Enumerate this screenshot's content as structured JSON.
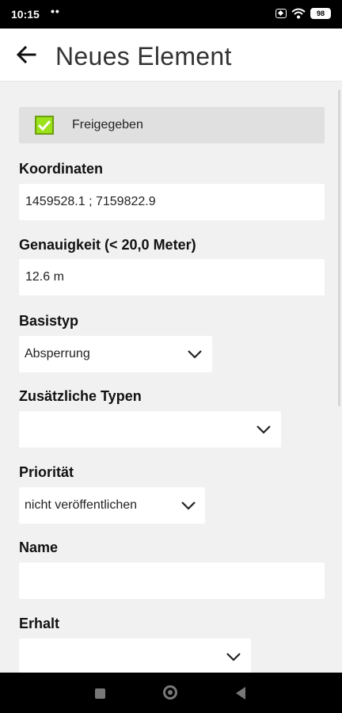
{
  "status_bar": {
    "time": "10:15",
    "dots": "••",
    "battery": "98"
  },
  "app_bar": {
    "title": "Neues Element",
    "back_icon": "arrow-left-icon"
  },
  "form": {
    "freigegeben": {
      "label": "Freigegeben",
      "checked": true,
      "accent": "#9be21a"
    },
    "koordinaten": {
      "label": "Koordinaten",
      "value": "1459528.1 ; 7159822.9"
    },
    "genauigkeit": {
      "label": "Genauigkeit (< 20,0 Meter)",
      "value": "12.6 m"
    },
    "basistyp": {
      "label": "Basistyp",
      "value": "Absperrung"
    },
    "zusaetzliche_typen": {
      "label": "Zusätzliche Typen",
      "value": ""
    },
    "prioritaet": {
      "label": "Priorität",
      "value": "nicht veröffentlichen"
    },
    "name": {
      "label": "Name",
      "value": ""
    },
    "erhalt": {
      "label": "Erhalt",
      "value": ""
    }
  }
}
